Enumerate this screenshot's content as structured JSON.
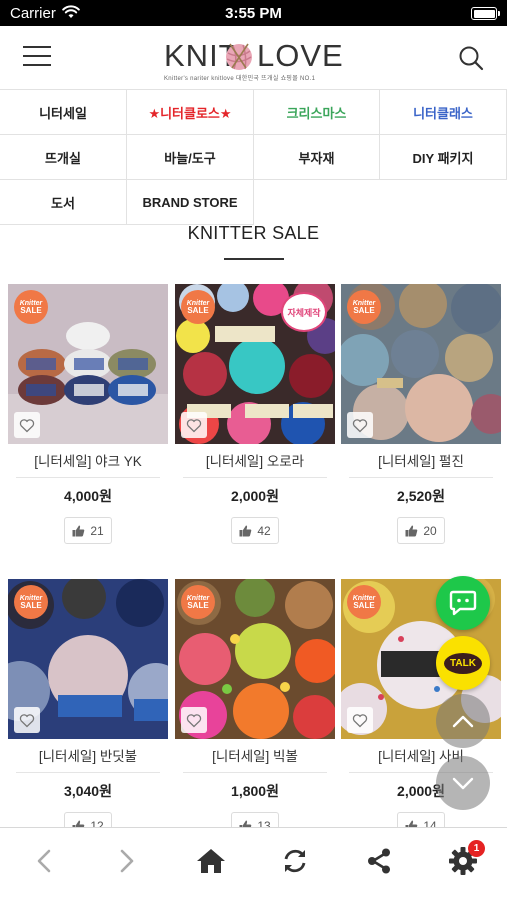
{
  "status_bar": {
    "carrier": "Carrier",
    "time": "3:55 PM"
  },
  "header": {
    "logo_left": "KNIT",
    "logo_right": "LOVE",
    "logo_tagline": "Knitter's nariter knitlove 대한민국 뜨개실 쇼핑몰 NO.1"
  },
  "categories": [
    {
      "label": "니터세일",
      "color": "#222222"
    },
    {
      "label": "★니터클로스★",
      "color": "#e4252a"
    },
    {
      "label": "크리스마스",
      "color": "#3aa55a"
    },
    {
      "label": "니터클래스",
      "color": "#3a64c8"
    },
    {
      "label": "뜨개실",
      "color": "#222222"
    },
    {
      "label": "바늘/도구",
      "color": "#222222"
    },
    {
      "label": "부자재",
      "color": "#222222"
    },
    {
      "label": "DIY 패키지",
      "color": "#222222"
    },
    {
      "label": "도서",
      "color": "#222222"
    },
    {
      "label": "BRAND STORE",
      "color": "#222222"
    }
  ],
  "section": {
    "title": "KNITTER SALE"
  },
  "badge": {
    "line1": "Knitter",
    "line2": "SALE"
  },
  "products": [
    {
      "name": "[니터세일] 야크 YK",
      "price": "4,000원",
      "likes": "21",
      "tag": ""
    },
    {
      "name": "[니터세일] 오로라",
      "price": "2,000원",
      "likes": "42",
      "tag": "자체제작"
    },
    {
      "name": "[니터세일] 펄진",
      "price": "2,520원",
      "likes": "20",
      "tag": ""
    },
    {
      "name": "[니터세일] 반딧불",
      "price": "3,040원",
      "likes": "12",
      "tag": ""
    },
    {
      "name": "[니터세일] 빅볼",
      "price": "1,800원",
      "likes": "13",
      "tag": ""
    },
    {
      "name": "[니터세일] 사비",
      "price": "2,000원",
      "likes": "14",
      "tag": ""
    }
  ],
  "floating": {
    "talk_label": "TALK"
  },
  "toolbar": {
    "notification_count": "1"
  },
  "colors": {
    "sale_badge": "#f07846",
    "chat_green": "#1ec84a",
    "kakao_yellow": "#fae100",
    "notification_red": "#e52222"
  },
  "icons": [
    "wifi-icon",
    "battery-icon",
    "menu-icon",
    "search-icon",
    "heart-icon",
    "thumbs-up-icon",
    "chat-icon",
    "kakao-talk-icon",
    "chevron-up-icon",
    "chevron-down-icon",
    "back-arrow-icon",
    "forward-arrow-icon",
    "home-icon",
    "refresh-icon",
    "share-icon",
    "gear-icon"
  ]
}
